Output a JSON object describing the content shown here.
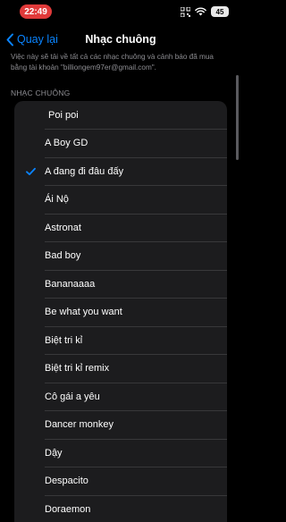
{
  "status_bar": {
    "time": "22:49",
    "battery": "45"
  },
  "nav": {
    "back_label": "Quay lại",
    "title": "Nhạc chuông"
  },
  "description": "Việc này sẽ tải về tất cả các nhạc chuông và cảnh báo đã mua bằng tài khoản \"billiongem97er@gmail.com\".",
  "section_header": "NHẠC CHUÔNG",
  "ringtones": [
    {
      "label": "Poi poi",
      "selected": false
    },
    {
      "label": "A Boy GD",
      "selected": false
    },
    {
      "label": "A đang đi đâu đấy",
      "selected": true
    },
    {
      "label": "Ái Nộ",
      "selected": false
    },
    {
      "label": "Astronat",
      "selected": false
    },
    {
      "label": "Bad boy",
      "selected": false
    },
    {
      "label": "Bananaaaa",
      "selected": false
    },
    {
      "label": "Be what you want",
      "selected": false
    },
    {
      "label": "Biệt tri kỉ",
      "selected": false
    },
    {
      "label": "Biệt tri kỉ remix",
      "selected": false
    },
    {
      "label": "Cô gái a yêu",
      "selected": false
    },
    {
      "label": "Dancer monkey",
      "selected": false
    },
    {
      "label": "Dậy",
      "selected": false
    },
    {
      "label": "Despacito",
      "selected": false
    },
    {
      "label": "Doraemon",
      "selected": false
    }
  ],
  "colors": {
    "accent": "#0a84ff",
    "time_pill": "#e03a3a",
    "list_background": "#1c1c1e",
    "secondary_text": "#8e8e93"
  }
}
